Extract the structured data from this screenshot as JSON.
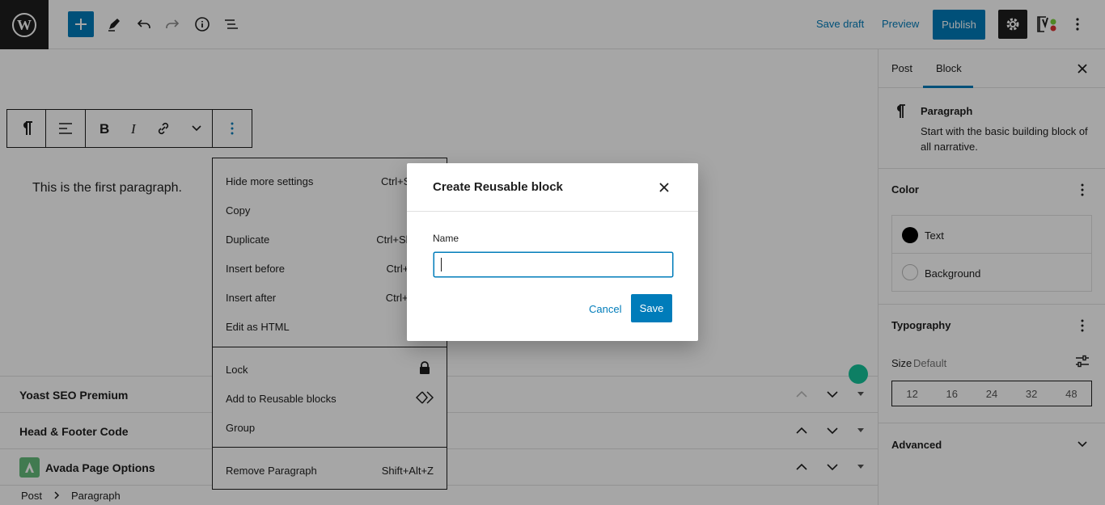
{
  "topbar": {
    "save_draft": "Save draft",
    "preview": "Preview",
    "publish": "Publish",
    "accent": "#007cba"
  },
  "editor": {
    "paragraph": "This is the first paragraph."
  },
  "metaboxes": [
    {
      "title": "Yoast SEO Premium"
    },
    {
      "title": "Head & Footer Code"
    },
    {
      "title": "Avada Page Options"
    }
  ],
  "breadcrumb": {
    "root": "Post",
    "current": "Paragraph"
  },
  "sidebar": {
    "tabs": [
      {
        "label": "Post"
      },
      {
        "label": "Block"
      }
    ],
    "block": {
      "name": "Paragraph",
      "description_line1": "Start with the basic building block of",
      "description_line2": "all narrative."
    },
    "color": {
      "heading": "Color",
      "text_label": "Text",
      "background_label": "Background"
    },
    "typography": {
      "heading": "Typography",
      "size_label": "Size",
      "size_value": "Default",
      "sizes": [
        "12",
        "16",
        "24",
        "32",
        "48"
      ]
    },
    "advanced": {
      "heading": "Advanced"
    }
  },
  "context_menu": {
    "items": [
      {
        "label": "Hide more settings",
        "shortcut": "Ctrl+Shift+,"
      },
      {
        "label": "Copy",
        "shortcut": ""
      },
      {
        "label": "Duplicate",
        "shortcut": "Ctrl+Shift+D"
      },
      {
        "label": "Insert before",
        "shortcut": "Ctrl+Alt+T"
      },
      {
        "label": "Insert after",
        "shortcut": "Ctrl+Alt+Y"
      },
      {
        "label": "Edit as HTML",
        "shortcut": ""
      }
    ],
    "lock": "Lock",
    "add_reusable": "Add to Reusable blocks",
    "group": "Group",
    "remove": "Remove Paragraph",
    "remove_shortcut": "Shift+Alt+Z"
  },
  "modal": {
    "title": "Create Reusable block",
    "name_label": "Name",
    "name_value": "",
    "cancel": "Cancel",
    "save": "Save"
  }
}
